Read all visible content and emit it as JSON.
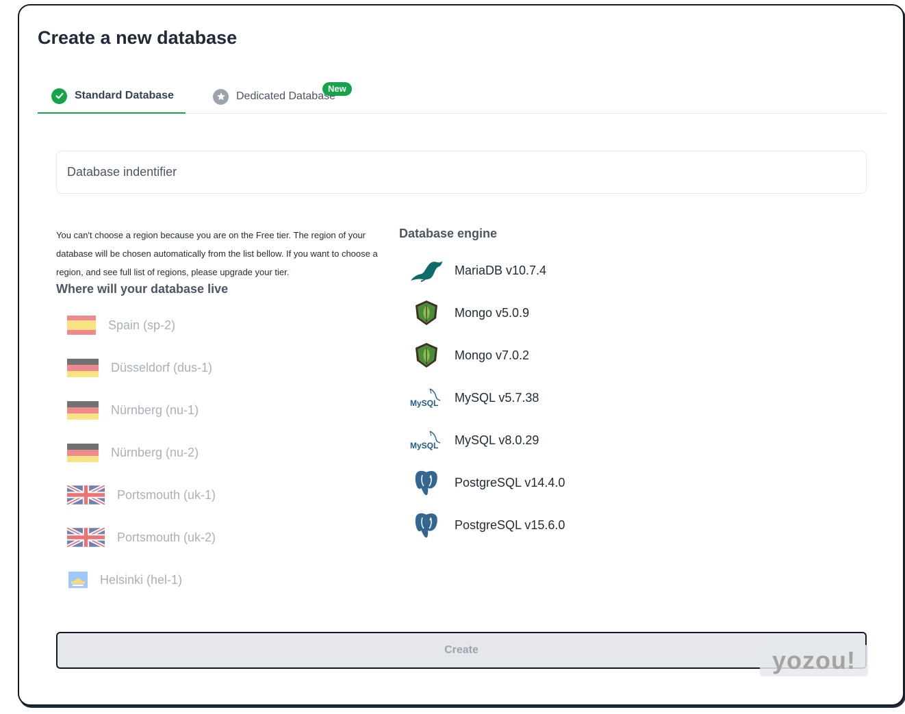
{
  "page": {
    "title": "Create a new database"
  },
  "tabs": {
    "standard_label": "Standard Database",
    "dedicated_label": "Dedicated Database",
    "dedicated_badge": "New"
  },
  "identifier": {
    "placeholder": "Database indentifier",
    "value": ""
  },
  "region": {
    "note": "You can't choose a region because you are on the Free tier. The region of your database will be chosen automatically from the list bellow. If you want to choose a region, and see full list of regions, please upgrade your tier.",
    "heading": "Where will your database live",
    "items": [
      {
        "label": "Spain (sp-2)",
        "flag": "spain-flag-icon"
      },
      {
        "label": "Düsseldorf (dus-1)",
        "flag": "germany-flag-icon"
      },
      {
        "label": "Nürnberg (nu-1)",
        "flag": "germany-flag-icon"
      },
      {
        "label": "Nürnberg (nu-2)",
        "flag": "germany-flag-icon"
      },
      {
        "label": "Portsmouth (uk-1)",
        "flag": "uk-flag-icon"
      },
      {
        "label": "Portsmouth (uk-2)",
        "flag": "uk-flag-icon"
      },
      {
        "label": "Helsinki (hel-1)",
        "flag": "helsinki-flag-icon"
      }
    ]
  },
  "engine": {
    "heading": "Database engine",
    "items": [
      {
        "label": "MariaDB v10.7.4",
        "icon": "mariadb-seal-icon"
      },
      {
        "label": "Mongo v5.0.9",
        "icon": "mongodb-leaf-icon"
      },
      {
        "label": "Mongo v7.0.2",
        "icon": "mongodb-leaf-icon"
      },
      {
        "label": "MySQL v5.7.38",
        "icon": "mysql-dolphin-icon",
        "logo_text": "MySQL"
      },
      {
        "label": "MySQL v8.0.29",
        "icon": "mysql-dolphin-icon",
        "logo_text": "MySQL"
      },
      {
        "label": "PostgreSQL v14.4.0",
        "icon": "postgresql-elephant-icon"
      },
      {
        "label": "PostgreSQL v15.6.0",
        "icon": "postgresql-elephant-icon"
      }
    ]
  },
  "actions": {
    "create_label": "Create"
  },
  "watermark": {
    "text": "yozou!"
  },
  "colors": {
    "accent_green": "#16a34a",
    "border_dark": "#111827",
    "muted_text": "#9ca3af",
    "disabled_button_bg": "#e5e7eb"
  }
}
